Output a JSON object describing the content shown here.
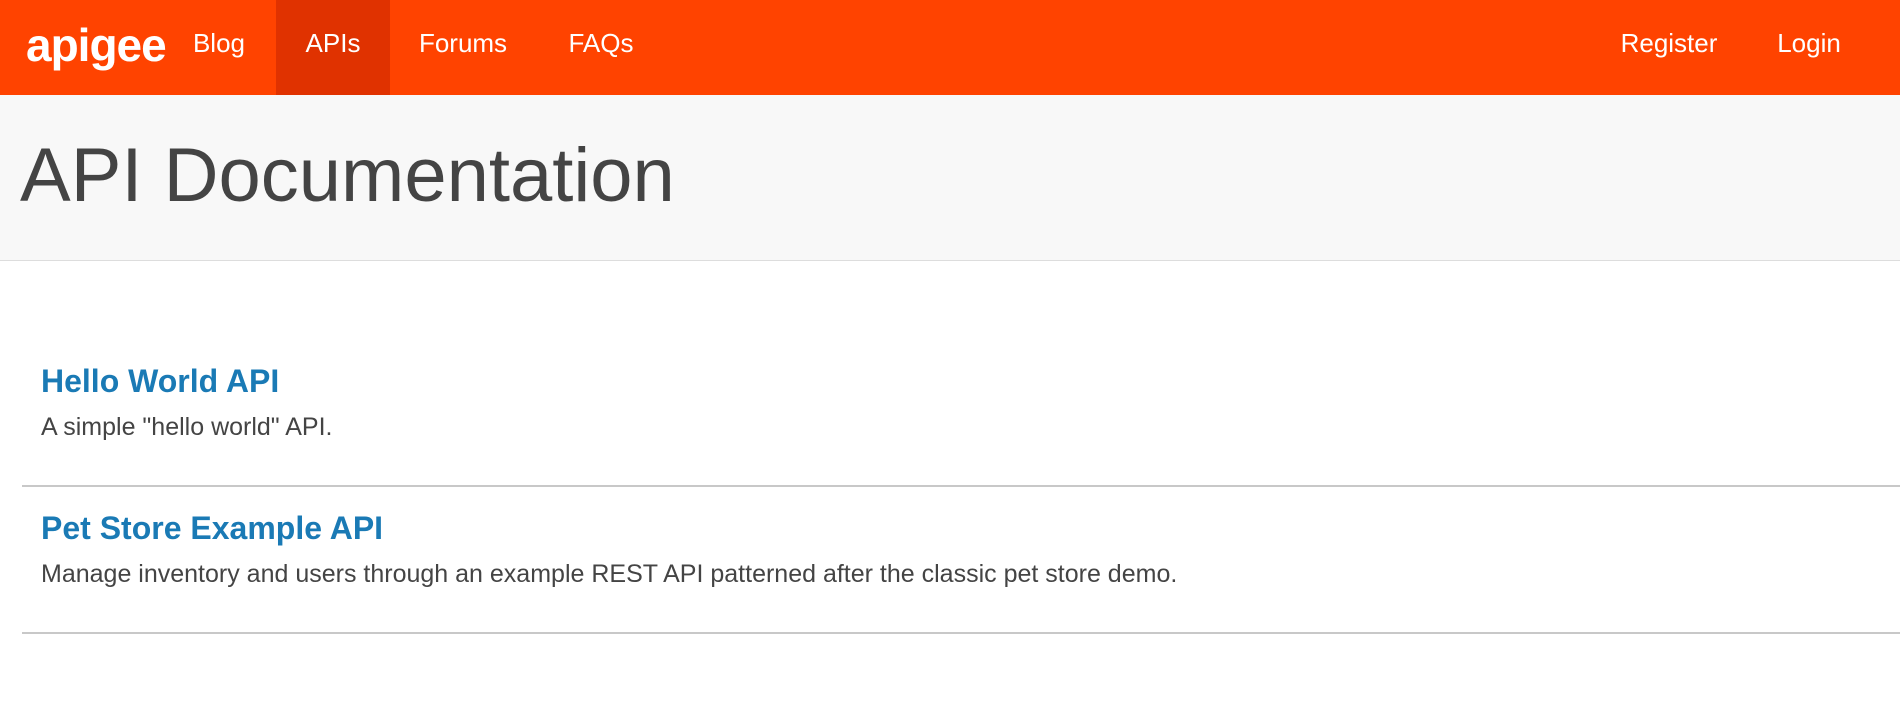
{
  "navbar": {
    "logo_text": "apigee",
    "left_items": [
      {
        "label": "Blog"
      },
      {
        "label": "APIs"
      },
      {
        "label": "Forums"
      },
      {
        "label": "FAQs"
      }
    ],
    "right_items": [
      {
        "label": "Register"
      },
      {
        "label": "Login"
      }
    ],
    "active_item": "APIs",
    "colors": {
      "background": "#ff4300",
      "active_background": "#e03200"
    }
  },
  "header": {
    "title": "API Documentation"
  },
  "apis": [
    {
      "title": "Hello World API",
      "description": "A simple \"hello world\" API."
    },
    {
      "title": "Pet Store Example API",
      "description": "Manage inventory and users through an example REST API patterned after the classic pet store demo."
    }
  ],
  "colors": {
    "link": "#1a7ab5",
    "text": "#444444"
  }
}
